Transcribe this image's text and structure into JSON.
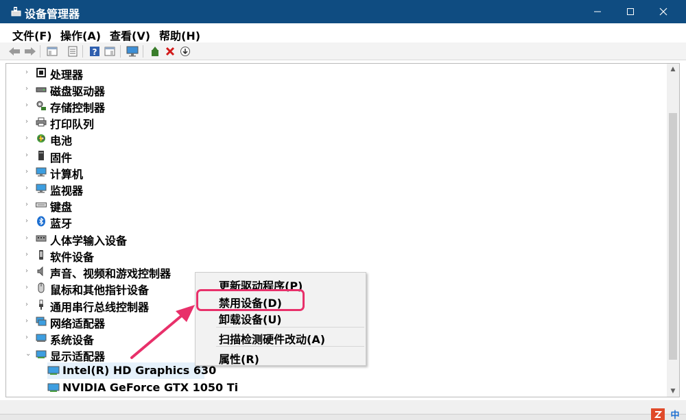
{
  "window": {
    "title": "设备管理器",
    "app_icon": "device-manager-icon",
    "controls": [
      "minimize-icon",
      "maximize-icon",
      "close-icon"
    ]
  },
  "menubar": {
    "items": [
      "文件(F)",
      "操作(A)",
      "查看(V)",
      "帮助(H)"
    ]
  },
  "toolbar": {
    "icons": [
      "back-arrow-icon",
      "forward-arrow-icon",
      "show-hide-console-tree-icon",
      "properties-icon",
      "help-icon",
      "action-pane-icon",
      "monitor-scan-icon",
      "update-driver-icon",
      "uninstall-x-icon",
      "download-driver-icon"
    ]
  },
  "tree": {
    "categories": [
      {
        "label": "处理器",
        "icon": "processor-icon",
        "expander": "›"
      },
      {
        "label": "磁盘驱动器",
        "icon": "disk-drive-icon",
        "expander": "›"
      },
      {
        "label": "存储控制器",
        "icon": "storage-controller-icon",
        "expander": "›"
      },
      {
        "label": "打印队列",
        "icon": "printer-icon",
        "expander": "›"
      },
      {
        "label": "电池",
        "icon": "battery-icon",
        "expander": "›"
      },
      {
        "label": "固件",
        "icon": "firmware-icon",
        "expander": "›"
      },
      {
        "label": "计算机",
        "icon": "computer-icon",
        "expander": "›"
      },
      {
        "label": "监视器",
        "icon": "monitor-icon",
        "expander": "›"
      },
      {
        "label": "键盘",
        "icon": "keyboard-icon",
        "expander": "›"
      },
      {
        "label": "蓝牙",
        "icon": "bluetooth-icon",
        "expander": "›"
      },
      {
        "label": "人体学输入设备",
        "icon": "hid-icon",
        "expander": "›"
      },
      {
        "label": "软件设备",
        "icon": "software-device-icon",
        "expander": "›"
      },
      {
        "label": "声音、视频和游戏控制器",
        "icon": "speaker-icon",
        "expander": "›"
      },
      {
        "label": "鼠标和其他指针设备",
        "icon": "mouse-icon",
        "expander": "›"
      },
      {
        "label": "通用串行总线控制器",
        "icon": "usb-icon",
        "expander": "›"
      },
      {
        "label": "网络适配器",
        "icon": "network-adapter-icon",
        "expander": "›"
      },
      {
        "label": "系统设备",
        "icon": "system-device-icon",
        "expander": "›"
      },
      {
        "label": "显示适配器",
        "icon": "display-adapter-icon",
        "expander": "⌄"
      }
    ],
    "display_adapters": [
      {
        "label": "Intel(R) HD Graphics 630",
        "icon": "display-adapter-icon",
        "selected": true
      },
      {
        "label": "NVIDIA GeForce GTX 1050 Ti",
        "icon": "display-adapter-icon",
        "selected": false
      }
    ]
  },
  "context_menu": {
    "items": [
      "更新驱动程序(P)",
      "禁用设备(D)",
      "卸载设备(U)",
      "扫描检测硬件改动(A)",
      "属性(R)"
    ],
    "highlighted_index": 1,
    "highlight_color": "#e8306a"
  },
  "taskbar": {
    "ime_labels": [
      "中"
    ]
  },
  "colors": {
    "titlebar": "#0f4c81",
    "selection": "#e5f1fb",
    "annotation": "#e8306a"
  }
}
